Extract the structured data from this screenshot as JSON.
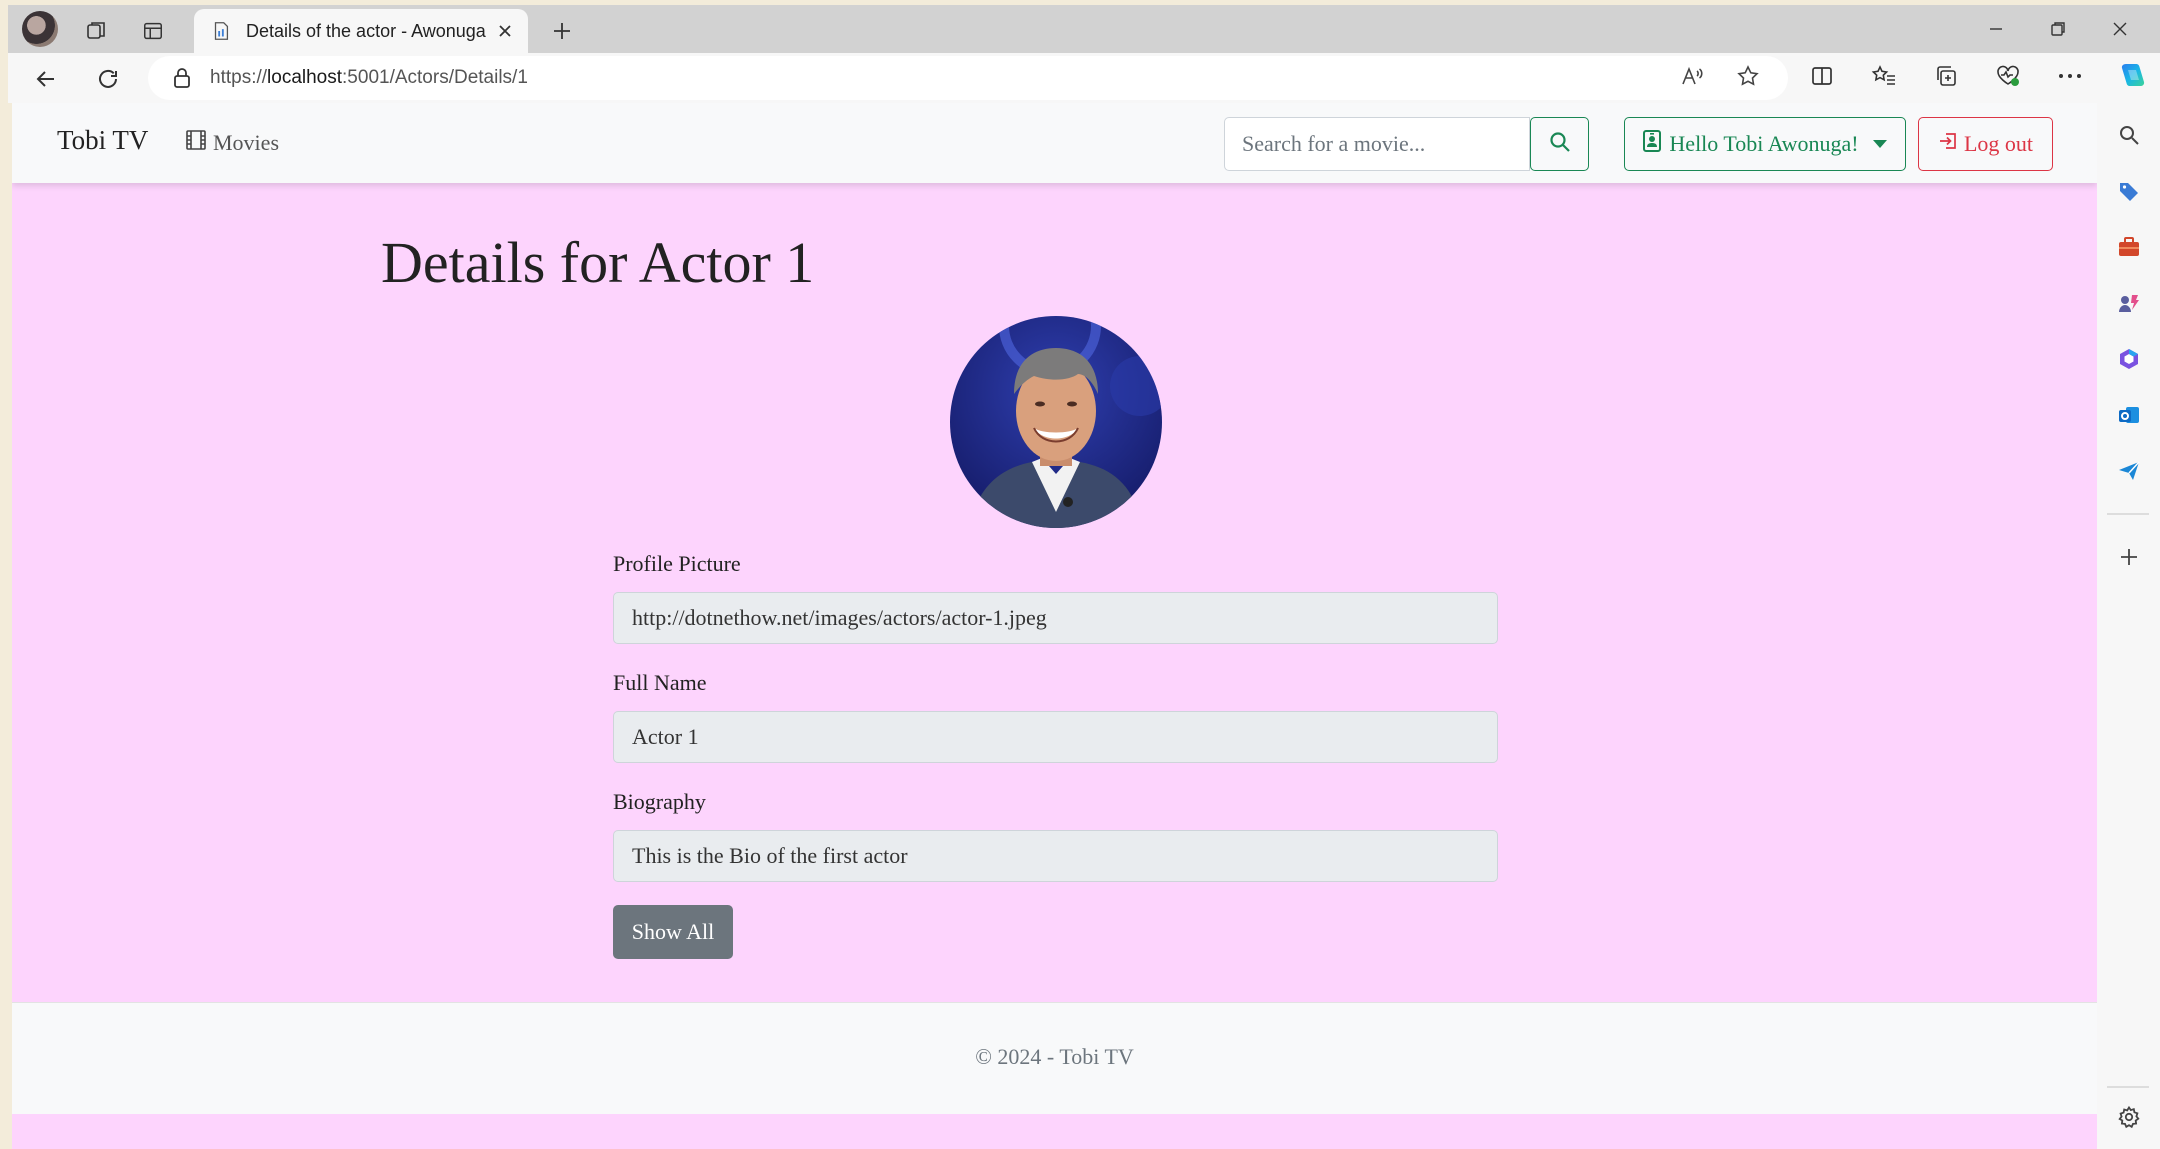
{
  "browser": {
    "tab": {
      "title": "Details of the actor - Awonuga"
    },
    "address": {
      "scheme": "https://",
      "host": "localhost",
      "rest": ":5001/Actors/Details/1"
    }
  },
  "site": {
    "brand": "Tobi TV",
    "nav": {
      "movies_label": "Movies"
    },
    "search": {
      "placeholder": "Search for a movie..."
    },
    "user_menu_label": "Hello Tobi Awonuga!",
    "logout_label": "Log out"
  },
  "page": {
    "title": "Details for Actor 1",
    "fields": [
      {
        "label": "Profile Picture",
        "value": "http://dotnethow.net/images/actors/actor-1.jpeg"
      },
      {
        "label": "Full Name",
        "value": "Actor 1"
      },
      {
        "label": "Biography",
        "value": "This is the Bio of the first actor"
      }
    ],
    "show_all_label": "Show All"
  },
  "footer": {
    "text": "© 2024 - Tobi TV"
  },
  "colors": {
    "page_background": "#fdd4fd",
    "success": "#198754",
    "danger": "#dc3545",
    "secondary": "#6c757d"
  },
  "icons": {
    "browser": [
      "profile-icon",
      "workspaces-icon",
      "tab-actions-icon",
      "page-icon",
      "close-icon",
      "plus-icon",
      "minimize-icon",
      "restore-icon",
      "back-icon",
      "refresh-icon",
      "lock-icon",
      "read-aloud-icon",
      "favorite-star-icon",
      "split-screen-icon",
      "favorites-icon",
      "collections-icon",
      "browser-essentials-icon",
      "more-icon",
      "copilot-icon"
    ],
    "sidebar": [
      "search-icon",
      "shopping-tag-icon",
      "tools-icon",
      "games-icon",
      "microsoft-365-icon",
      "outlook-icon",
      "send-icon",
      "add-icon",
      "settings-icon"
    ],
    "site": [
      "film-icon",
      "search-icon",
      "person-badge-icon",
      "logout-icon"
    ]
  }
}
